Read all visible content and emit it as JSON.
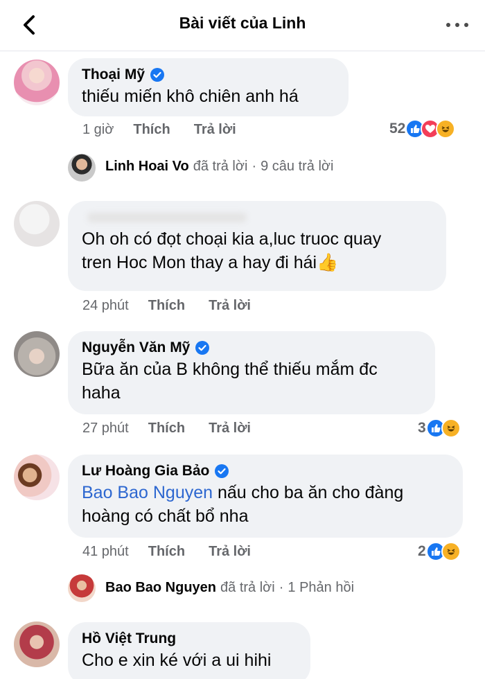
{
  "header": {
    "title": "Bài viết của Linh",
    "back_icon": "back-icon",
    "more_icon": "more-icon"
  },
  "comments": [
    {
      "name": "Thoại Mỹ",
      "verified": true,
      "text": "thiếu miến khô chiên anh há",
      "time": "1 giờ",
      "like": "Thích",
      "reply": "Trả lời",
      "reactions": "52"
    },
    {
      "name": "",
      "verified": false,
      "text_line1": "Oh oh có đọt choại kia a,luc truoc quay",
      "text_line2": "tren Hoc Mon thay a hay đi hái",
      "emoji": "👍",
      "time": "24 phút",
      "like": "Thích",
      "reply": "Trả lời"
    },
    {
      "name": "Nguyễn Văn Mỹ",
      "verified": true,
      "text_line1": "Bữa ăn của B không thể thiếu mắm đc",
      "text_line2": "haha",
      "time": "27 phút",
      "like": "Thích",
      "reply": "Trả lời",
      "reactions": "3"
    },
    {
      "name": "Lư Hoàng Gia Bảo",
      "verified": true,
      "mention": "Bao Bao Nguyen",
      "text_line1": "nấu cho ba ăn cho đàng",
      "text_line2": "hoàng có chất bổ nha",
      "time": "41 phút",
      "like": "Thích",
      "reply": "Trả lời",
      "reactions": "2"
    },
    {
      "name": "Hồ Việt Trung",
      "verified": false,
      "text": "Cho e xin ké với a ui hihi"
    }
  ],
  "replies": [
    {
      "name": "Linh Hoai Vo",
      "action": "đã trả lời",
      "sep": "·",
      "count": "9 câu trả lời"
    },
    {
      "name": "Bao Bao Nguyen",
      "action": "đã trả lời",
      "sep": "·",
      "count": "1 Phản hồi"
    }
  ],
  "colors": {
    "bubble": "#f0f2f5",
    "meta": "#65676b",
    "mention": "#2d67d0",
    "verified": "#1877f2",
    "like": "#1877f2",
    "love": "#f33e58",
    "haha": "#f7b125"
  }
}
